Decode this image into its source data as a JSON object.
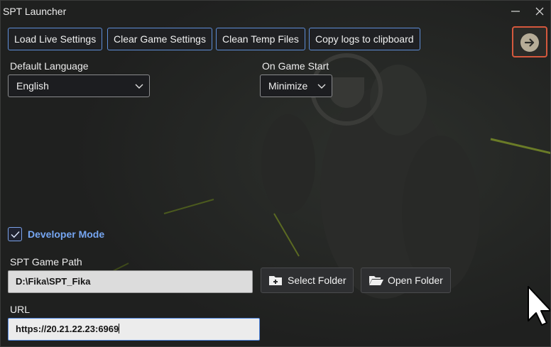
{
  "window": {
    "title": "SPT Launcher"
  },
  "toolbar": {
    "load_live_settings": "Load Live Settings",
    "clear_game_settings": "Clear Game Settings",
    "clean_temp_files": "Clean Temp Files",
    "copy_logs": "Copy logs to clipboard"
  },
  "settings": {
    "default_language_label": "Default Language",
    "default_language_value": "English",
    "on_game_start_label": "On Game Start",
    "on_game_start_value": "Minimize"
  },
  "developer": {
    "mode_label": "Developer Mode",
    "mode_checked": true,
    "game_path_label": "SPT Game Path",
    "game_path_value": "D:\\Fika\\SPT_Fika",
    "select_folder": "Select Folder",
    "open_folder": "Open Folder",
    "url_label": "URL",
    "url_value": "https://20.21.22.23:6969"
  },
  "icons": {
    "next": "arrow-right-circle-icon",
    "select_folder": "folder-plus-icon",
    "open_folder": "folder-open-icon",
    "chevron": "chevron-down-icon",
    "check": "check-icon"
  },
  "colors": {
    "accent": "#5e8ed8",
    "developer_label": "#76a6f2",
    "next_button_border": "#d5583d"
  }
}
